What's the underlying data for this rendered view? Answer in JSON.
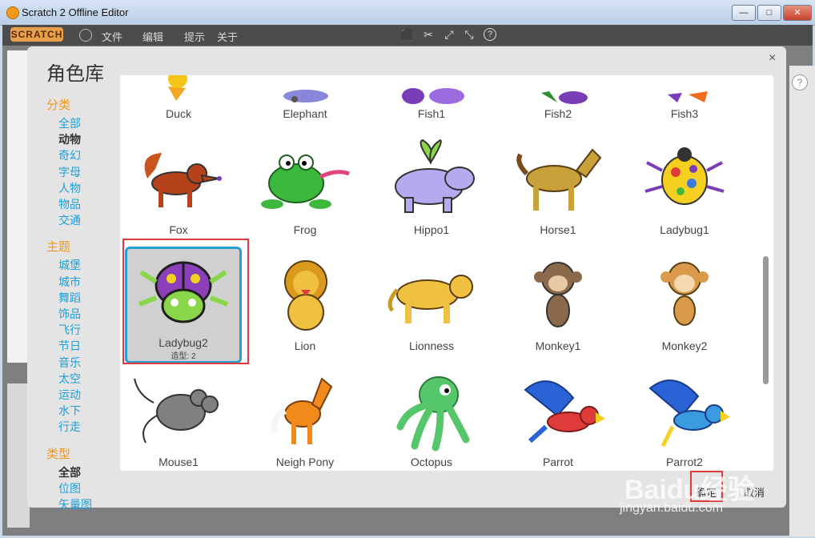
{
  "window": {
    "title": "Scratch 2 Offline Editor",
    "minimize": "—",
    "maximize": "□",
    "close": "✕"
  },
  "menubar": {
    "logo": "SCRATCH",
    "items": [
      "文件",
      "编辑",
      "提示",
      "关于"
    ]
  },
  "dialog": {
    "title": "角色库",
    "close_label": "×",
    "sections": [
      {
        "title": "分类",
        "items": [
          "全部",
          "动物",
          "奇幻",
          "字母",
          "人物",
          "物品",
          "交通"
        ],
        "active": "动物"
      },
      {
        "title": "主题",
        "items": [
          "城堡",
          "城市",
          "舞蹈",
          "饰品",
          "飞行",
          "节日",
          "音乐",
          "太空",
          "运动",
          "水下",
          "行走"
        ]
      },
      {
        "title": "类型",
        "items": [
          "全部",
          "位图",
          "矢量图"
        ],
        "active": "全部"
      }
    ],
    "sprites": [
      {
        "name": "Duck"
      },
      {
        "name": "Elephant"
      },
      {
        "name": "Fish1"
      },
      {
        "name": "Fish2"
      },
      {
        "name": "Fish3"
      },
      {
        "name": "Fox"
      },
      {
        "name": "Frog"
      },
      {
        "name": "Hippo1"
      },
      {
        "name": "Horse1"
      },
      {
        "name": "Ladybug1"
      },
      {
        "name": "Ladybug2",
        "costumes": "造型: 2"
      },
      {
        "name": "Lion"
      },
      {
        "name": "Lionness"
      },
      {
        "name": "Monkey1"
      },
      {
        "name": "Monkey2"
      },
      {
        "name": "Mouse1"
      },
      {
        "name": "Neigh Pony"
      },
      {
        "name": "Octopus"
      },
      {
        "name": "Parrot"
      },
      {
        "name": "Parrot2"
      }
    ],
    "selected_sprite": "Ladybug2",
    "ok_button": "确定",
    "cancel_button": "取消"
  },
  "watermark": {
    "brand": "Baidu经验",
    "url": "jingyan.baidu.com"
  },
  "icons": {
    "help": "?",
    "globe": "globe-icon"
  }
}
